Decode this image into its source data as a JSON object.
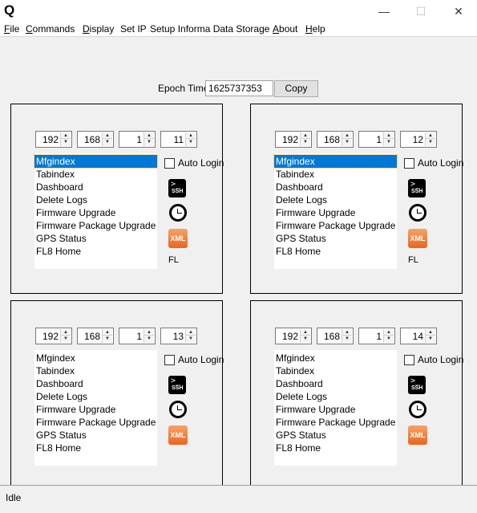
{
  "window": {
    "app_icon": "Q",
    "minimize": "—",
    "maximize": "☐",
    "close": "✕"
  },
  "menu": [
    "File",
    "Commands",
    "Display",
    "Set IP",
    "Setup Informa Data Storage",
    "About",
    "Help"
  ],
  "epoch": {
    "label": "Epoch Time",
    "value": "1625737353",
    "copy_label": "Copy"
  },
  "panels": [
    {
      "ip": [
        "192",
        "168",
        "1",
        "11"
      ],
      "items": [
        "Mfgindex",
        "Tabindex",
        "Dashboard",
        "Delete Logs",
        "Firmware Upgrade",
        "Firmware Package Upgrade",
        "GPS Status",
        "FL8 Home"
      ],
      "selected": 0,
      "auto_login_label": "Auto Login",
      "auto_login_checked": false,
      "ssh_prompt": ">_",
      "ssh_text": "SSH",
      "xml_text": "XML",
      "footer_label": "FL"
    },
    {
      "ip": [
        "192",
        "168",
        "1",
        "12"
      ],
      "items": [
        "Mfgindex",
        "Tabindex",
        "Dashboard",
        "Delete Logs",
        "Firmware Upgrade",
        "Firmware Package Upgrade",
        "GPS Status",
        "FL8 Home"
      ],
      "selected": 0,
      "auto_login_label": "Auto Login",
      "auto_login_checked": false,
      "ssh_prompt": ">_",
      "ssh_text": "SSH",
      "xml_text": "XML",
      "footer_label": "FL"
    },
    {
      "ip": [
        "192",
        "168",
        "1",
        "13"
      ],
      "items": [
        "Mfgindex",
        "Tabindex",
        "Dashboard",
        "Delete Logs",
        "Firmware Upgrade",
        "Firmware Package Upgrade",
        "GPS Status",
        "FL8 Home"
      ],
      "selected": -1,
      "auto_login_label": "Auto Login",
      "auto_login_checked": false,
      "ssh_prompt": ">_",
      "ssh_text": "SSH",
      "xml_text": "XML",
      "footer_label": ""
    },
    {
      "ip": [
        "192",
        "168",
        "1",
        "14"
      ],
      "items": [
        "Mfgindex",
        "Tabindex",
        "Dashboard",
        "Delete Logs",
        "Firmware Upgrade",
        "Firmware Package Upgrade",
        "GPS Status",
        "FL8 Home"
      ],
      "selected": -1,
      "auto_login_label": "Auto Login",
      "auto_login_checked": false,
      "ssh_prompt": ">_",
      "ssh_text": "SSH",
      "xml_text": "XML",
      "footer_label": ""
    }
  ],
  "status": {
    "text": "Idle"
  },
  "colors": {
    "selection": "#0078d7",
    "window_bg": "#f0f0f0"
  }
}
